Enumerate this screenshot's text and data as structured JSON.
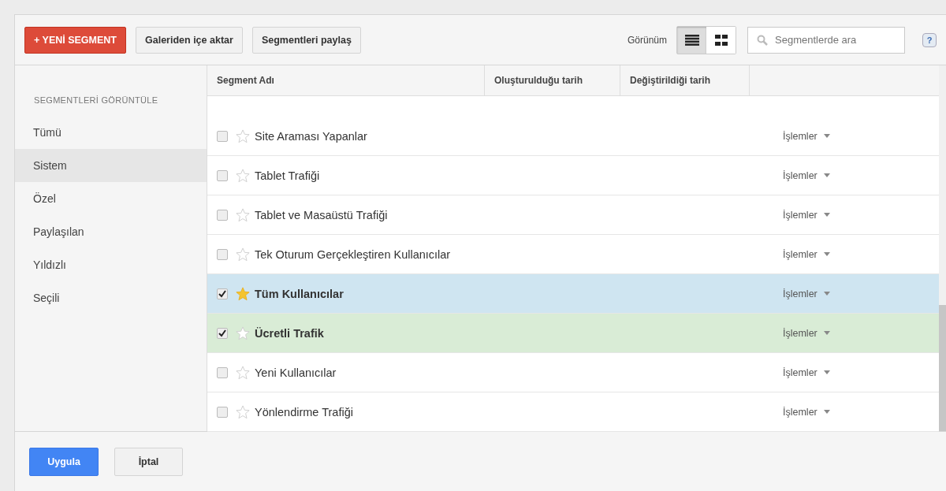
{
  "toolbar": {
    "new_button": "+ YENİ SEGMENT",
    "import_button": "Galeriden içe aktar",
    "share_button": "Segmentleri paylaş",
    "view_label": "Görünüm",
    "view_modes": [
      {
        "kind": "list",
        "selected": true
      },
      {
        "kind": "grid",
        "selected": false
      }
    ],
    "search": {
      "placeholder": "Segmentlerde ara"
    },
    "help": "?"
  },
  "sidebar": {
    "heading": "SEGMENTLERİ GÖRÜNTÜLE",
    "items": [
      {
        "label": "Tümü",
        "selected": false
      },
      {
        "label": "Sistem",
        "selected": true
      },
      {
        "label": "Özel",
        "selected": false
      },
      {
        "label": "Paylaşılan",
        "selected": false
      },
      {
        "label": "Yıldızlı",
        "selected": false
      },
      {
        "label": "Seçili",
        "selected": false
      }
    ]
  },
  "table": {
    "columns": [
      "Segment Adı",
      "Oluşturulduğu tarih",
      "Değiştirildiği tarih"
    ],
    "rows": [
      {
        "name": "Site Araması Yapanlar",
        "checked": false,
        "starred": false,
        "actions": "İşlemler"
      },
      {
        "name": "Tablet Trafiği",
        "checked": false,
        "starred": false,
        "actions": "İşlemler"
      },
      {
        "name": "Tablet ve Masaüstü Trafiği",
        "checked": false,
        "starred": false,
        "actions": "İşlemler"
      },
      {
        "name": "Tek Oturum Gerçekleştiren Kullanıcılar",
        "checked": false,
        "starred": false,
        "actions": "İşlemler"
      },
      {
        "name": "Tüm Kullanıcılar",
        "checked": true,
        "starred": true,
        "color": "#cfe5f1",
        "actions": "İşlemler"
      },
      {
        "name": "Ücretli Trafik",
        "checked": true,
        "starred": false,
        "color": "#d9ecd6",
        "actions": "İşlemler"
      },
      {
        "name": "Yeni Kullanıcılar",
        "checked": false,
        "starred": false,
        "actions": "İşlemler"
      },
      {
        "name": "Yönlendirme Trafiği",
        "checked": false,
        "starred": false,
        "actions": "İşlemler"
      }
    ]
  },
  "footer": {
    "apply_button": "Uygula",
    "cancel_button": "İptal"
  }
}
